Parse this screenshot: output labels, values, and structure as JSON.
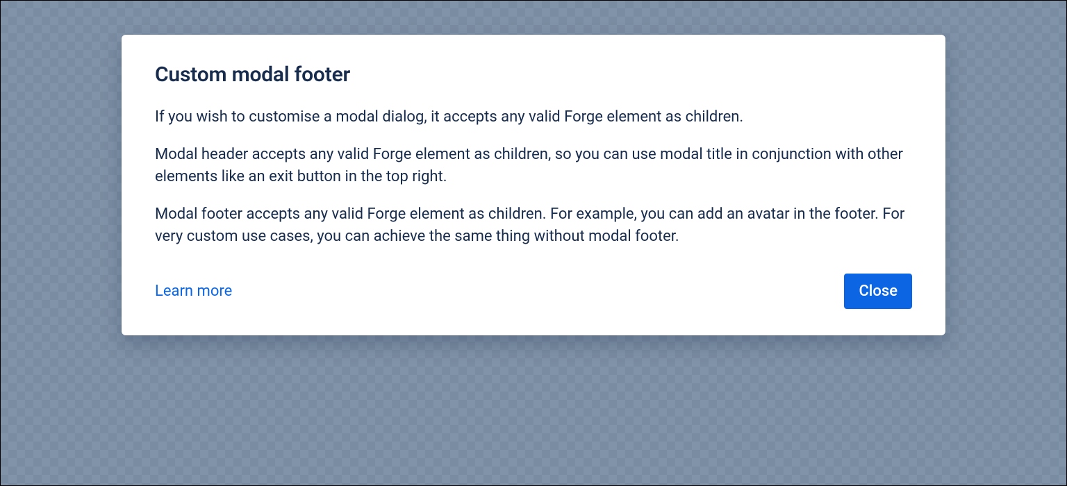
{
  "modal": {
    "title": "Custom modal footer",
    "body": {
      "p1": "If you wish to customise a modal dialog, it accepts any valid Forge element as children.",
      "p2": "Modal header accepts any valid Forge element as children, so you can use modal title in conjunction with other elements like an exit button in the top right.",
      "p3": "Modal footer accepts any valid Forge element as children. For example, you can add an avatar in the footer. For very custom use cases, you can achieve the same thing without modal footer."
    },
    "footer": {
      "learn_more_label": "Learn more",
      "close_label": "Close"
    }
  }
}
